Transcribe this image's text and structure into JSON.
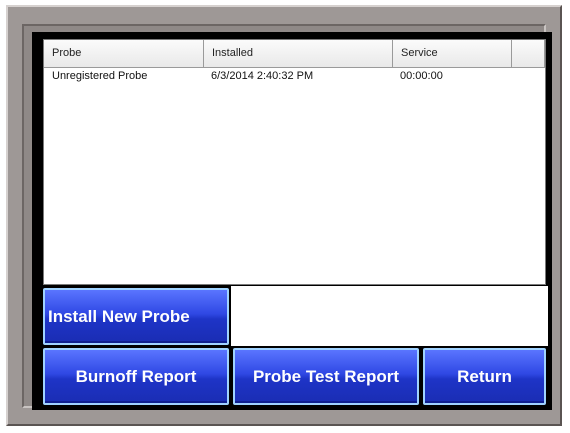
{
  "table": {
    "columns": [
      "Probe",
      "Installed",
      "Service",
      ""
    ],
    "rows": [
      {
        "probe": "Unregistered Probe",
        "installed": "6/3/2014 2:40:32 PM",
        "service": "00:00:00"
      }
    ]
  },
  "buttons": {
    "install_new_probe": "Install New Probe",
    "burnoff_report": "Burnoff Report",
    "probe_test_report": "Probe Test Report",
    "return": "Return"
  },
  "colors": {
    "button_blue": "#2f48e4",
    "button_border": "#9fd2ff",
    "bezel": "#9e9896"
  }
}
